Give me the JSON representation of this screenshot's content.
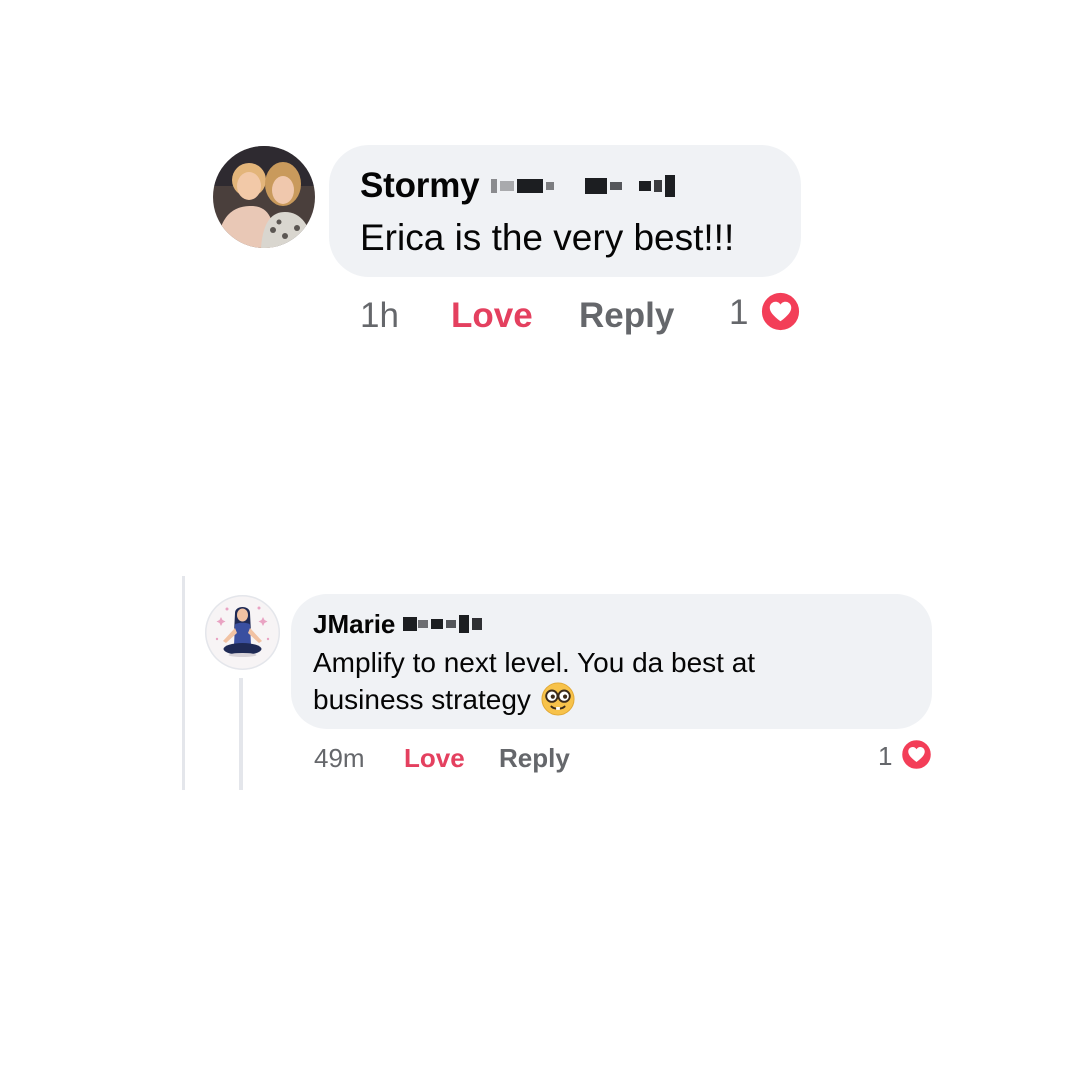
{
  "colors": {
    "bubble_bg": "#f0f2f5",
    "love_accent": "#e4405f",
    "secondary_text": "#65676b",
    "primary_text": "#050505",
    "heart_red": "#f33e58"
  },
  "comments": [
    {
      "author": "Stormy",
      "author_redacted": true,
      "avatar_icon": "photo-avatar-two-women",
      "text": "Erica is the very best!!!",
      "time": "1h",
      "love_label": "Love",
      "reply_label": "Reply",
      "reaction_count": "1",
      "reaction_icon": "heart-icon"
    },
    {
      "author": "JMarie",
      "author_redacted": true,
      "avatar_icon": "meditating-woman-avatar",
      "text": "Amplify to next level. You da best at business strategy",
      "emoji_icon": "nerd-face-emoji",
      "time": "49m",
      "love_label": "Love",
      "reply_label": "Reply",
      "reaction_count": "1",
      "reaction_icon": "heart-icon"
    }
  ]
}
